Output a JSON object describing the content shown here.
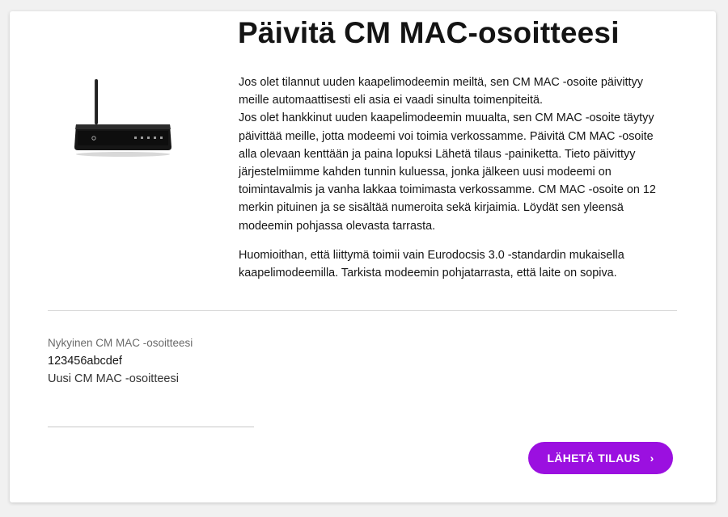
{
  "page": {
    "title": "Päivitä CM MAC-osoitteesi"
  },
  "intro": {
    "line1": "Jos olet tilannut uuden kaapelimodeemin meiltä, sen CM MAC -osoite päivittyy meille automaattisesti eli asia ei vaadi sinulta toimenpiteitä.",
    "line2": "Jos olet hankkinut uuden kaapelimodeemin muualta, sen CM MAC -osoite täytyy päivittää meille, jotta modeemi voi toimia verkossamme. Päivitä CM MAC -osoite alla olevaan kenttään ja paina lopuksi Lähetä tilaus -painiketta. Tieto päivittyy järjestelmiimme kahden tunnin kuluessa, jonka jälkeen uusi modeemi on toimintavalmis ja vanha lakkaa toimimasta verkossamme. CM MAC -osoite on 12 merkin pituinen ja se sisältää numeroita sekä kirjaimia. Löydät sen yleensä modeemin pohjassa olevasta tarrasta.",
    "note": "Huomioithan, että liittymä toimii vain Eurodocsis 3.0 -standardin mukaisella kaapelimodeemilla. Tarkista modeemin pohjatarrasta, että laite on sopiva."
  },
  "form": {
    "current_label": "Nykyinen CM MAC -osoitteesi",
    "current_value": "123456abcdef",
    "new_label": "Uusi CM MAC -osoitteesi",
    "new_value": "",
    "submit_label": "LÄHETÄ TILAUS",
    "submit_icon": "chevron-right-icon"
  },
  "colors": {
    "accent": "#9b10e0",
    "background": "#f1f1f1",
    "card": "#ffffff"
  }
}
